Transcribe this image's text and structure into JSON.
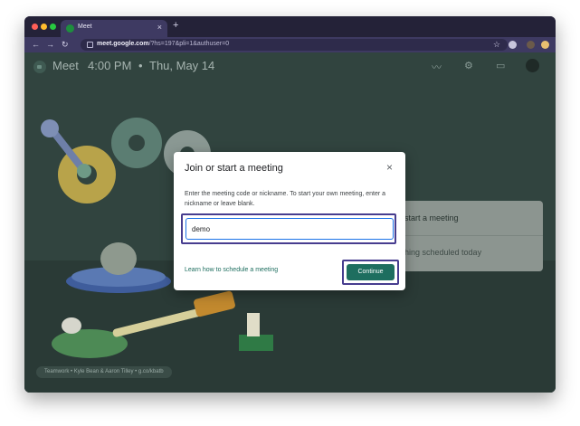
{
  "browser": {
    "tab_title": "Meet",
    "tab_close": "×",
    "new_tab": "+",
    "url_domain": "meet.google.com",
    "url_rest": "/?hs=197&pli=1&authuser=0",
    "nav_back": "←",
    "nav_forward": "→",
    "nav_reload": "↻",
    "bookmark_star": "☆"
  },
  "header": {
    "app_name": "Meet",
    "time": "4:00 PM",
    "separator": "•",
    "date": "Thu, May 14",
    "icons": [
      "chart-icon",
      "gear-icon",
      "feedback-icon",
      "avatar"
    ]
  },
  "side_panel": {
    "start_meeting": "start a meeting",
    "no_meetings": "hing scheduled today"
  },
  "credit": "Teamwork • Kyle Bean & Aaron Tilley • g.co/kbatb",
  "dialog": {
    "title": "Join or start a meeting",
    "close": "×",
    "description": "Enter the meeting code or nickname. To start your own meeting, enter a nickname or leave blank.",
    "input_value": "demo",
    "learn_link": "Learn how to schedule a meeting",
    "continue_label": "Continue"
  },
  "colors": {
    "accent": "#1e6e5f",
    "highlight": "#473d8f",
    "browser_chrome": "#3e3a62"
  }
}
